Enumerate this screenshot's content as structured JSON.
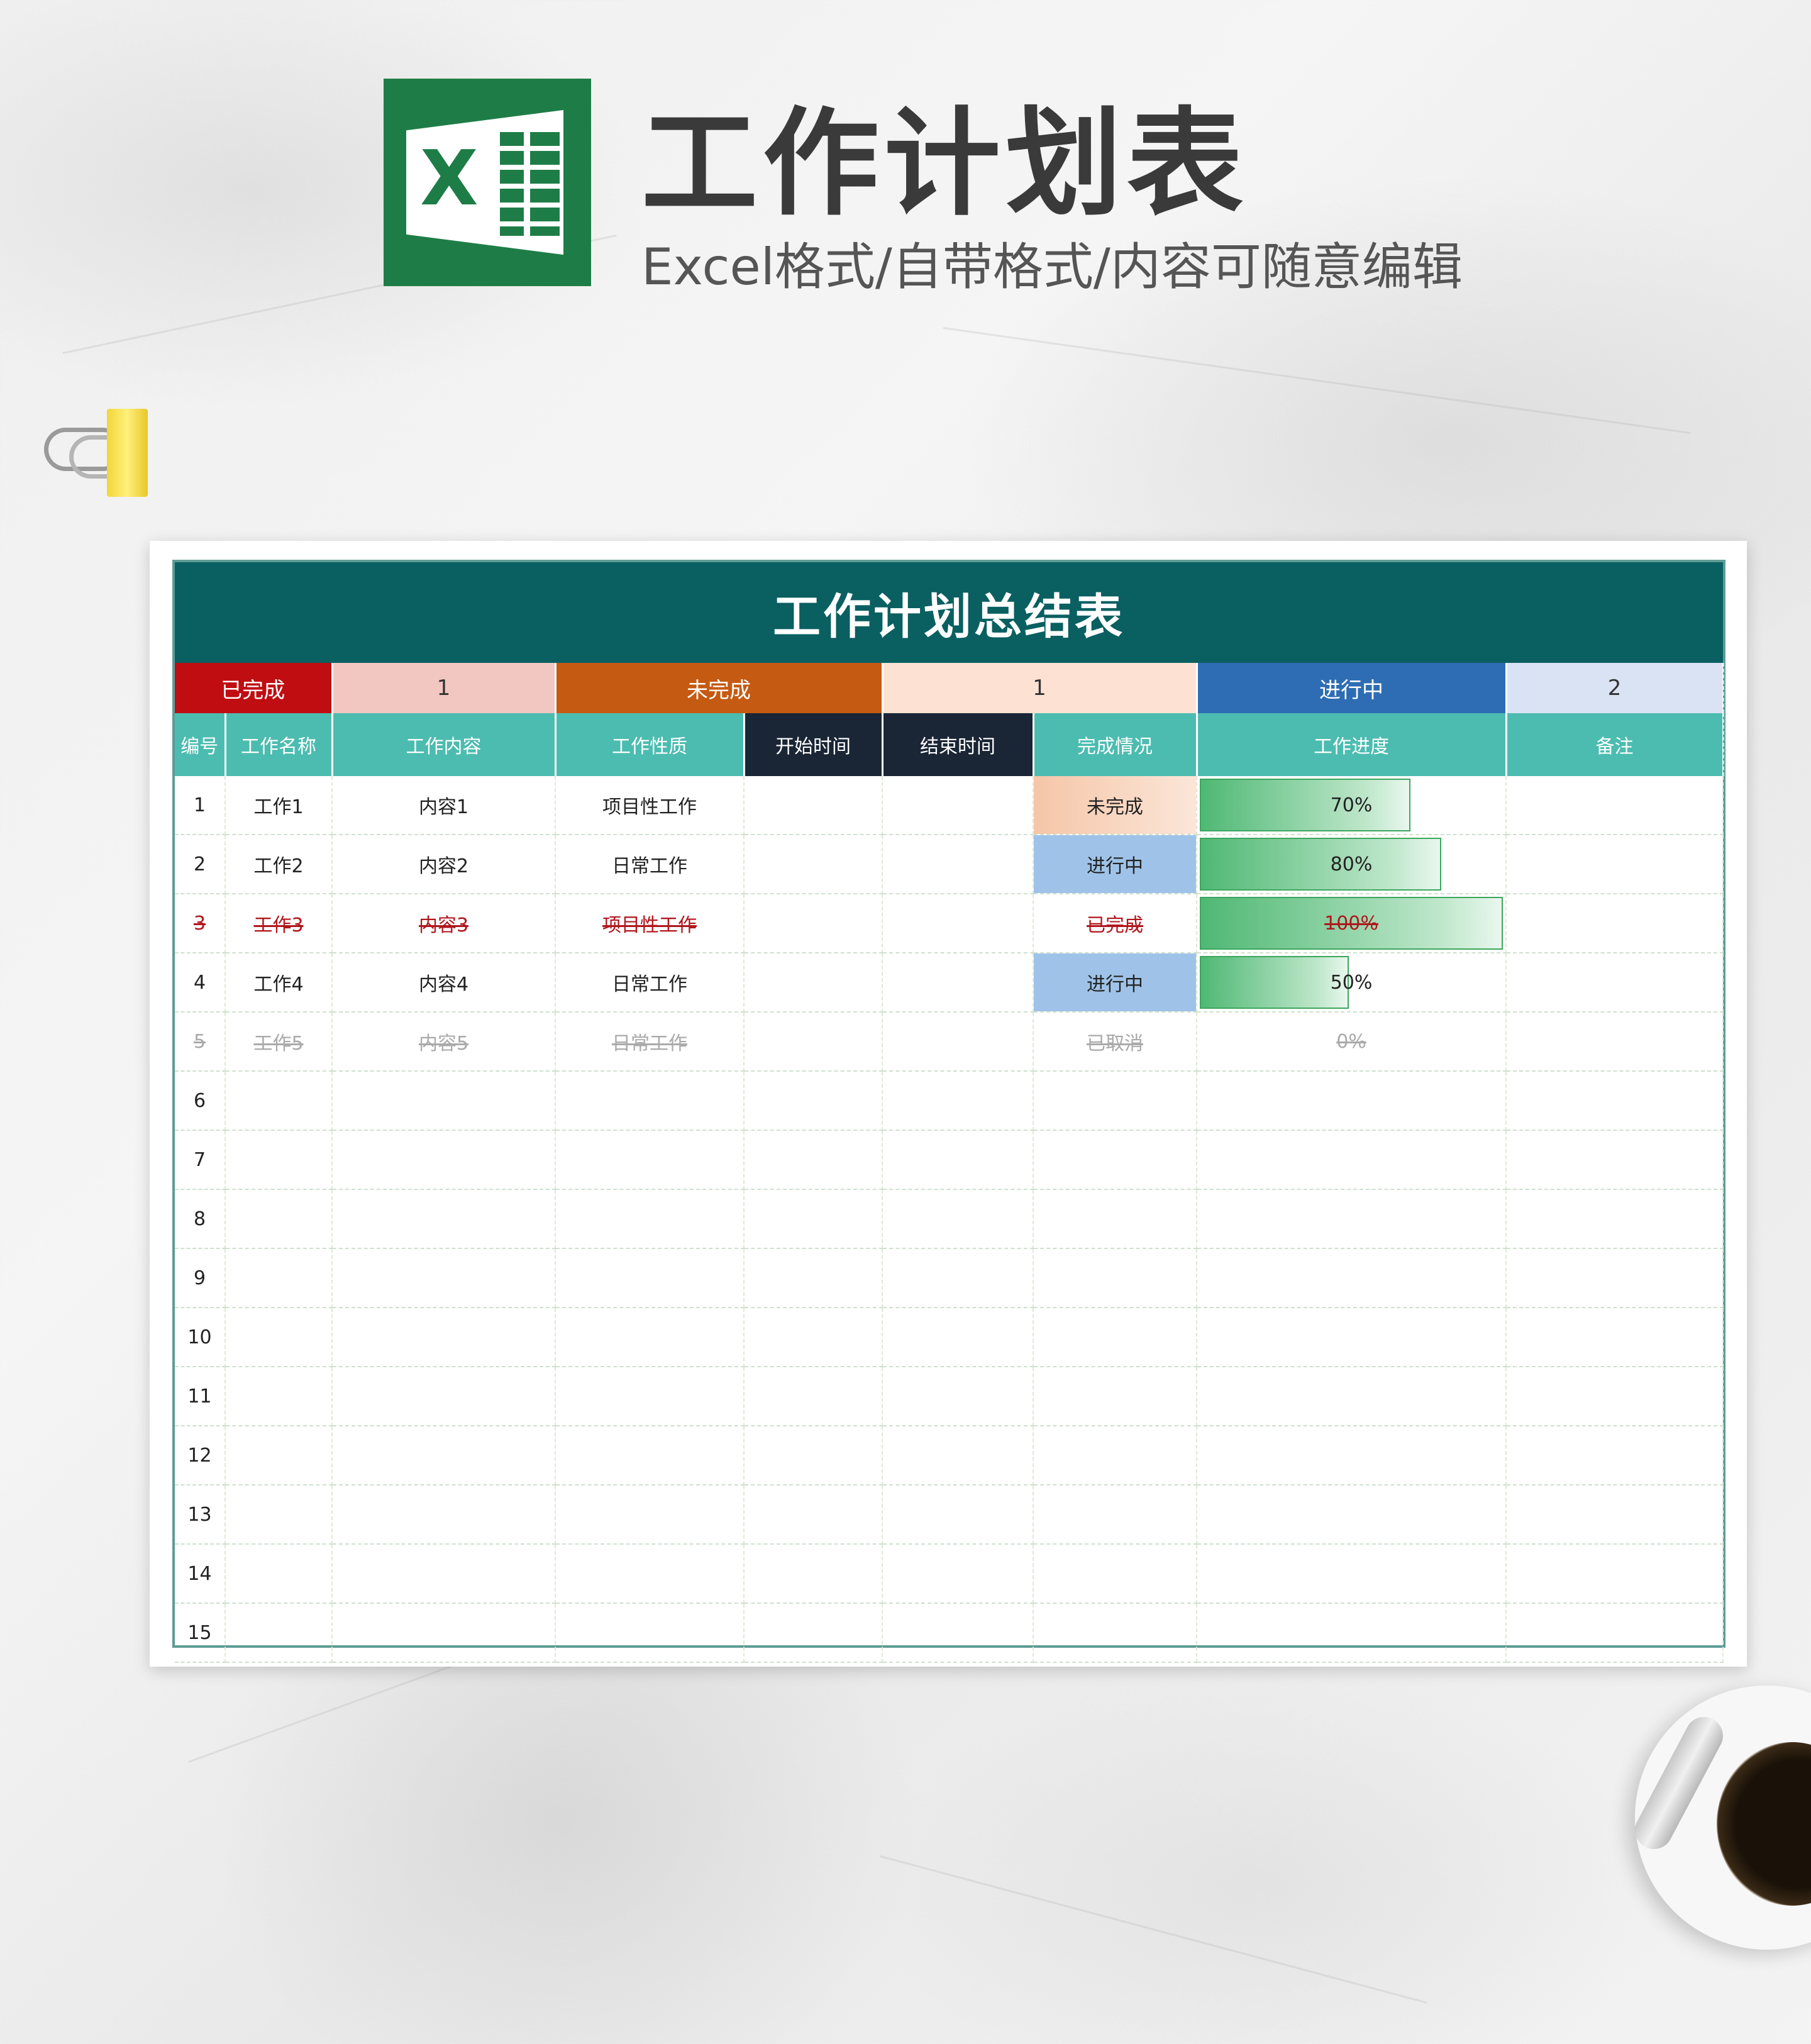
{
  "header": {
    "title": "工作计划表",
    "subtitle": "Excel格式/自带格式/内容可随意编辑",
    "logo_letter": "X"
  },
  "sheet": {
    "title": "工作计划总结表",
    "summary": [
      {
        "label": "已完成",
        "count": "1",
        "label_color": "#c00d12",
        "count_color": "#f2c6c1"
      },
      {
        "label": "未完成",
        "count": "1",
        "label_color": "#c55a13",
        "count_color": "#fde2d3"
      },
      {
        "label": "进行中",
        "count": "2",
        "label_color": "#2e6db3",
        "count_color": "#dae3f3"
      }
    ],
    "columns": [
      "编号",
      "工作名称",
      "工作内容",
      "工作性质",
      "开始时间",
      "结束时间",
      "完成情况",
      "工作进度",
      "备注"
    ],
    "rows": [
      {
        "no": "1",
        "name": "工作1",
        "content": "内容1",
        "nature": "项目性工作",
        "start": "",
        "end": "",
        "status": "未完成",
        "progress": "70%",
        "progress_value": 0.7,
        "note": "",
        "state": "undone"
      },
      {
        "no": "2",
        "name": "工作2",
        "content": "内容2",
        "nature": "日常工作",
        "start": "",
        "end": "",
        "status": "进行中",
        "progress": "80%",
        "progress_value": 0.8,
        "note": "",
        "state": "ongoing"
      },
      {
        "no": "3",
        "name": "工作3",
        "content": "内容3",
        "nature": "项目性工作",
        "start": "",
        "end": "",
        "status": "已完成",
        "progress": "100%",
        "progress_value": 1.0,
        "note": "",
        "state": "done"
      },
      {
        "no": "4",
        "name": "工作4",
        "content": "内容4",
        "nature": "日常工作",
        "start": "",
        "end": "",
        "status": "进行中",
        "progress": "50%",
        "progress_value": 0.5,
        "note": "",
        "state": "ongoing"
      },
      {
        "no": "5",
        "name": "工作5",
        "content": "内容5",
        "nature": "日常工作",
        "start": "",
        "end": "",
        "status": "已取消",
        "progress": "0%",
        "progress_value": 0.0,
        "note": "",
        "state": "cancel"
      },
      {
        "no": "6"
      },
      {
        "no": "7"
      },
      {
        "no": "8"
      },
      {
        "no": "9"
      },
      {
        "no": "10"
      },
      {
        "no": "11"
      },
      {
        "no": "12"
      },
      {
        "no": "13"
      },
      {
        "no": "14"
      },
      {
        "no": "15"
      }
    ]
  }
}
